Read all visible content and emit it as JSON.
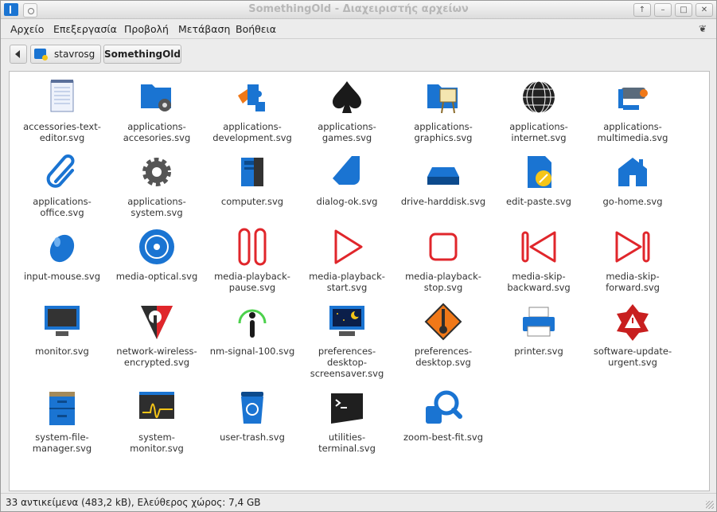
{
  "window": {
    "title": "SomethingOld - Διαχειριστής αρχείων",
    "buttons": [
      "↑",
      "–",
      "□",
      "✕"
    ]
  },
  "menu": [
    {
      "label": "Αρχείο"
    },
    {
      "label": "Επεξεργασία"
    },
    {
      "label": "Προβολή"
    },
    {
      "label": "Μετάβαση"
    },
    {
      "label": "Βοήθεια"
    }
  ],
  "menu_right_icon": "❦",
  "breadcrumb": {
    "home": "stavrosg",
    "current": "SomethingOld"
  },
  "files": [
    {
      "name": "accessories-text-editor.svg",
      "line1": "accessories-text-",
      "line2": "editor.svg",
      "icon": "notepad-icon"
    },
    {
      "name": "applications-accesories.svg",
      "line1": "applications-",
      "line2": "accesories.svg",
      "icon": "folder-gear-icon"
    },
    {
      "name": "applications-development.svg",
      "line1": "applications-",
      "line2": "development.svg",
      "icon": "puzzle-icon"
    },
    {
      "name": "applications-games.svg",
      "line1": "applications-",
      "line2": "games.svg",
      "icon": "spade-icon"
    },
    {
      "name": "applications-graphics.svg",
      "line1": "applications-",
      "line2": "graphics.svg",
      "icon": "easel-icon"
    },
    {
      "name": "applications-internet.svg",
      "line1": "applications-",
      "line2": "internet.svg",
      "icon": "globe-icon"
    },
    {
      "name": "applications-multimedia.svg",
      "line1": "applications-",
      "line2": "multimedia.svg",
      "icon": "camera-icon"
    },
    {
      "name": "applications-office.svg",
      "line1": "applications-",
      "line2": "office.svg",
      "icon": "paperclip-icon"
    },
    {
      "name": "applications-system.svg",
      "line1": "applications-",
      "line2": "system.svg",
      "icon": "gear-icon"
    },
    {
      "name": "computer.svg",
      "line1": "computer.svg",
      "line2": "",
      "icon": "computer-icon"
    },
    {
      "name": "dialog-ok.svg",
      "line1": "dialog-ok.svg",
      "line2": "",
      "icon": "check-icon"
    },
    {
      "name": "drive-harddisk.svg",
      "line1": "drive-harddisk.svg",
      "line2": "",
      "icon": "harddisk-icon"
    },
    {
      "name": "edit-paste.svg",
      "line1": "edit-paste.svg",
      "line2": "",
      "icon": "paste-icon"
    },
    {
      "name": "go-home.svg",
      "line1": "go-home.svg",
      "line2": "",
      "icon": "home-icon"
    },
    {
      "name": "input-mouse.svg",
      "line1": "input-mouse.svg",
      "line2": "",
      "icon": "mouse-icon"
    },
    {
      "name": "media-optical.svg",
      "line1": "media-optical.svg",
      "line2": "",
      "icon": "disc-icon"
    },
    {
      "name": "media-playback-pause.svg",
      "line1": "media-playback-",
      "line2": "pause.svg",
      "icon": "pause-icon"
    },
    {
      "name": "media-playback-start.svg",
      "line1": "media-playback-",
      "line2": "start.svg",
      "icon": "play-icon"
    },
    {
      "name": "media-playback-stop.svg",
      "line1": "media-playback-",
      "line2": "stop.svg",
      "icon": "stop-icon"
    },
    {
      "name": "media-skip-backward.svg",
      "line1": "media-skip-",
      "line2": "backward.svg",
      "icon": "skip-backward-icon"
    },
    {
      "name": "media-skip-forward.svg",
      "line1": "media-skip-",
      "line2": "forward.svg",
      "icon": "skip-forward-icon"
    },
    {
      "name": "monitor.svg",
      "line1": "monitor.svg",
      "line2": "",
      "icon": "monitor-icon"
    },
    {
      "name": "network-wireless-encrypted.svg",
      "line1": "network-wireless-",
      "line2": "encrypted.svg",
      "icon": "shield-icon"
    },
    {
      "name": "nm-signal-100.svg",
      "line1": "nm-signal-100.svg",
      "line2": "",
      "icon": "signal-icon"
    },
    {
      "name": "preferences-desktop-screensaver.svg",
      "line1": "preferences-",
      "line2": "desktop-",
      "line3": "screensaver.svg",
      "icon": "screensaver-icon"
    },
    {
      "name": "preferences-desktop.svg",
      "line1": "preferences-",
      "line2": "desktop.svg",
      "icon": "wrench-sign-icon"
    },
    {
      "name": "printer.svg",
      "line1": "printer.svg",
      "line2": "",
      "icon": "printer-icon"
    },
    {
      "name": "software-update-urgent.svg",
      "line1": "software-update-",
      "line2": "urgent.svg",
      "icon": "warning-icon"
    },
    {
      "name": "system-file-manager.svg",
      "line1": "system-file-",
      "line2": "manager.svg",
      "icon": "cabinet-icon"
    },
    {
      "name": "system-monitor.svg",
      "line1": "system-",
      "line2": "monitor.svg",
      "icon": "sysmonitor-icon"
    },
    {
      "name": "user-trash.svg",
      "line1": "user-trash.svg",
      "line2": "",
      "icon": "trash-icon"
    },
    {
      "name": "utilities-terminal.svg",
      "line1": "utilities-",
      "line2": "terminal.svg",
      "icon": "terminal-icon"
    },
    {
      "name": "zoom-best-fit.svg",
      "line1": "zoom-best-fit.svg",
      "line2": "",
      "icon": "zoom-icon"
    }
  ],
  "status": "33 αντικείμενα (483,2 kB), Ελεύθερος χώρος: 7,4 GB",
  "colors": {
    "accent": "#1a74d2",
    "red": "#e0262b",
    "dark": "#2e2e2e"
  }
}
